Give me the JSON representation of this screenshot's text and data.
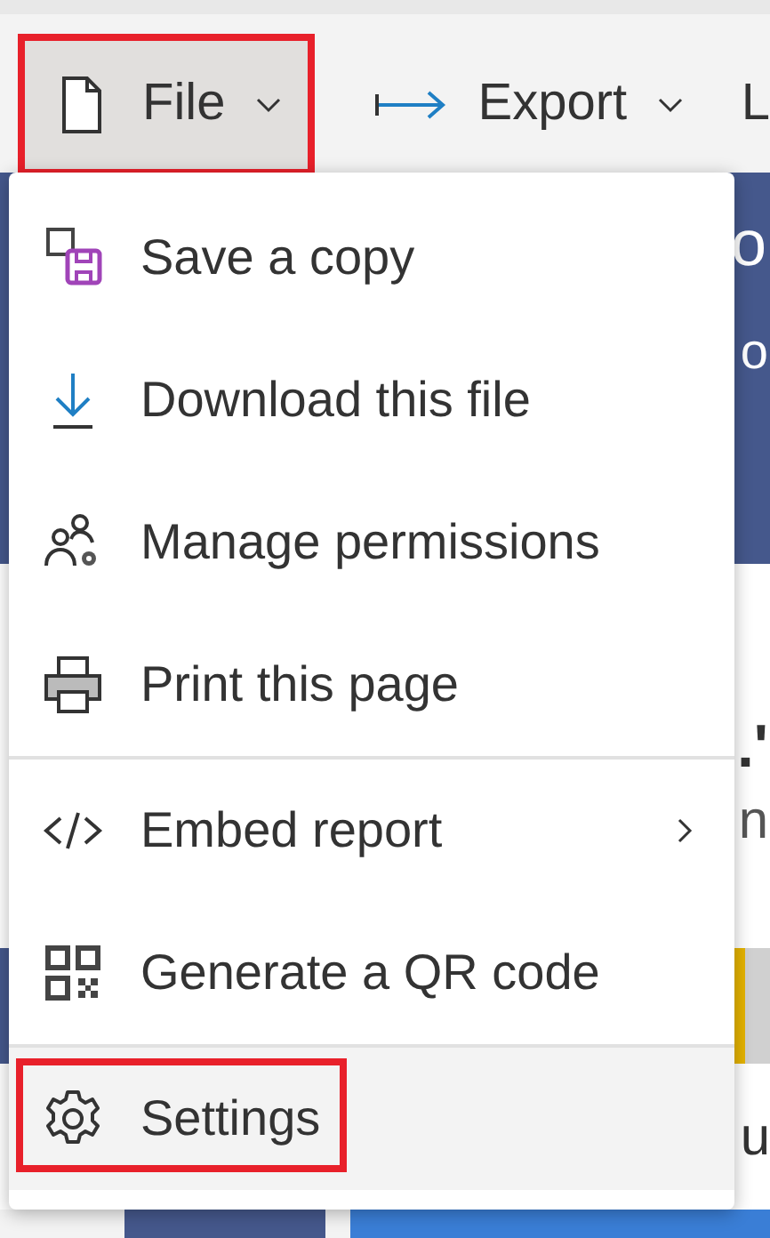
{
  "toolbar": {
    "buttons": [
      {
        "kind": "file",
        "label": "File",
        "highlighted": true,
        "selected": true
      },
      {
        "kind": "export",
        "label": "Export",
        "highlighted": false,
        "selected": false
      }
    ],
    "cut_label": "L"
  },
  "report": {
    "fragments": [
      "o",
      "o",
      ".'",
      "n",
      "u"
    ]
  },
  "menu": {
    "sections": [
      [
        {
          "kind": "save",
          "label": "Save a copy",
          "submenu": false,
          "selected": false,
          "highlighted": false
        },
        {
          "kind": "download",
          "label": "Download this file",
          "submenu": false,
          "selected": false,
          "highlighted": false
        },
        {
          "kind": "permissions",
          "label": "Manage permissions",
          "submenu": false,
          "selected": false,
          "highlighted": false
        },
        {
          "kind": "print",
          "label": "Print this page",
          "submenu": false,
          "selected": false,
          "highlighted": false
        }
      ],
      [
        {
          "kind": "embed",
          "label": "Embed report",
          "submenu": true,
          "selected": false,
          "highlighted": false
        },
        {
          "kind": "qr",
          "label": "Generate a QR code",
          "submenu": false,
          "selected": false,
          "highlighted": false
        }
      ],
      [
        {
          "kind": "settings",
          "label": "Settings",
          "submenu": false,
          "selected": true,
          "highlighted": true
        }
      ]
    ]
  }
}
